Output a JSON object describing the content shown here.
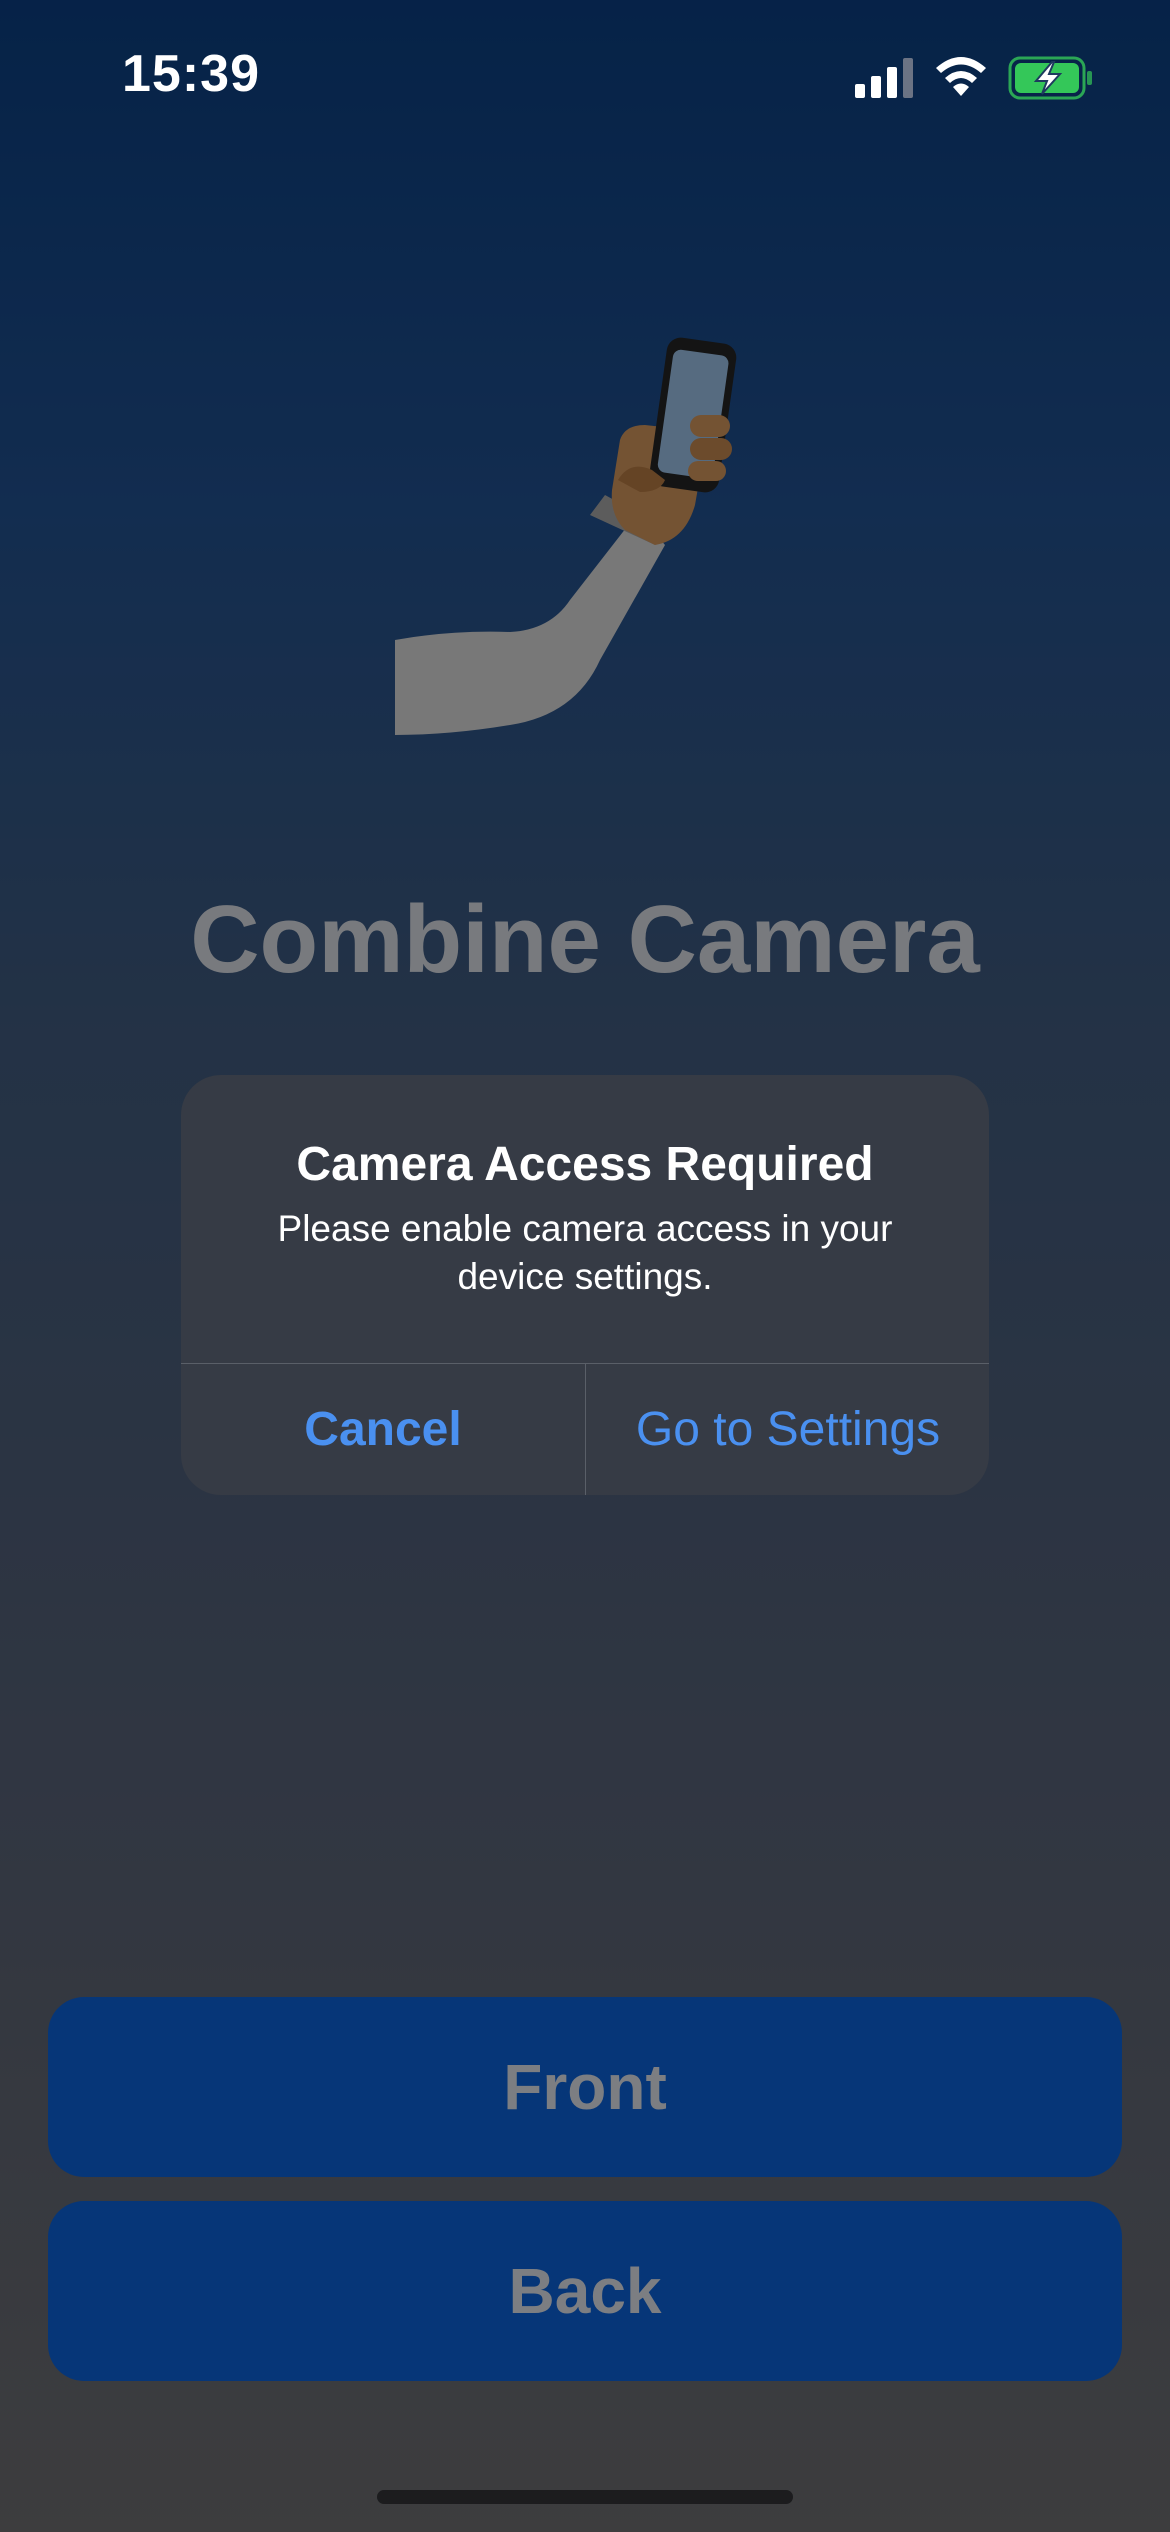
{
  "status_bar": {
    "time": "15:39",
    "signal_icon": "cellular-signal-icon",
    "wifi_icon": "wifi-icon",
    "battery_icon": "battery-charging-icon",
    "battery_color": "#34c759"
  },
  "hero": {
    "icon": "selfie-hand-icon"
  },
  "app": {
    "title": "Combine Camera"
  },
  "buttons": {
    "front": "Front",
    "back": "Back",
    "color": "#0a5ac8"
  },
  "alert": {
    "title": "Camera Access Required",
    "message": "Please enable camera access in your device settings.",
    "cancel": "Cancel",
    "settings": "Go to Settings",
    "button_color": "#4a90f0"
  }
}
